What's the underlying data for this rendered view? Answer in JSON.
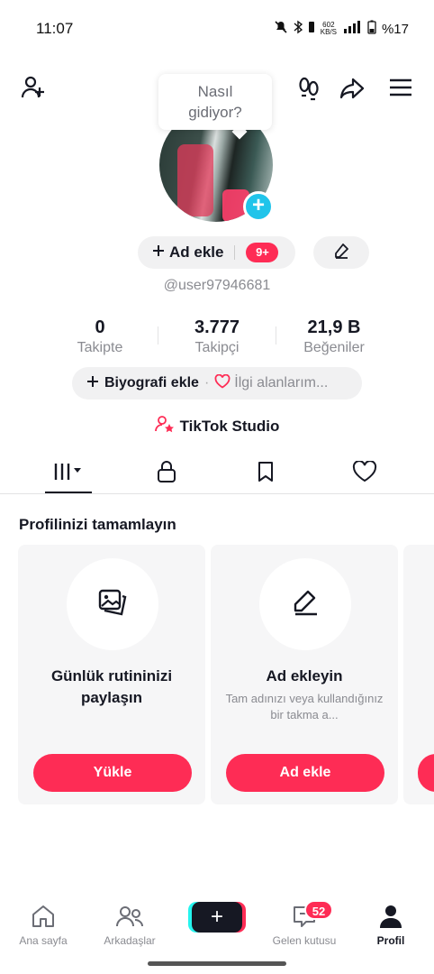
{
  "status_bar": {
    "time": "11:07",
    "net_speed_value": "602",
    "net_speed_unit": "KB/S",
    "battery": "%17"
  },
  "tooltip": {
    "line1": "Nasıl",
    "line2": "gidiyor?"
  },
  "profile": {
    "add_name_label": "Ad ekle",
    "notification_badge": "9+",
    "username": "@user97946681",
    "stats": [
      {
        "value": "0",
        "label": "Takipte"
      },
      {
        "value": "3.777",
        "label": "Takipçi"
      },
      {
        "value": "21,9 B",
        "label": "Beğeniler"
      }
    ],
    "bio_button": "Biyografi ekle",
    "bio_separator": "·",
    "interests_button": "İlgi alanlarım...",
    "studio_label": "TikTok Studio"
  },
  "complete_profile": {
    "title": "Profilinizi tamamlayın",
    "cards": [
      {
        "title": "Günlük rutininizi paylaşın",
        "description": "",
        "button": "Yükle",
        "icon": "photo-icon"
      },
      {
        "title": "Ad ekleyin",
        "description": "Tam adınızı veya kullandığınız bir takma a...",
        "button": "Ad ekle",
        "icon": "pencil-icon"
      }
    ]
  },
  "bottom_nav": {
    "items": [
      {
        "label": "Ana sayfa",
        "icon": "home-icon"
      },
      {
        "label": "Arkadaşlar",
        "icon": "friends-icon"
      },
      {
        "label": "",
        "icon": "create-icon"
      },
      {
        "label": "Gelen kutusu",
        "icon": "inbox-icon"
      },
      {
        "label": "Profil",
        "icon": "profile-icon"
      }
    ],
    "inbox_badge": "52"
  },
  "colors": {
    "accent": "#fe2c55",
    "cyan": "#25f4ee",
    "text": "#161823",
    "muted": "#8a8b91"
  }
}
